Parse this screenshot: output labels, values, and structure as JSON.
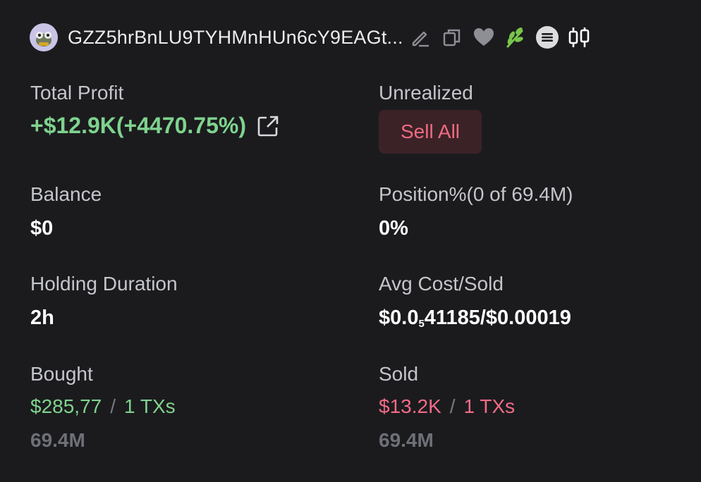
{
  "header": {
    "address": "GZZ5hrBnLU9TYHMnHUn6cY9EAGt..."
  },
  "total_profit": {
    "label": "Total Profit",
    "value": "+$12.9K(+4470.75%)"
  },
  "unrealized": {
    "label": "Unrealized",
    "sell_all_label": "Sell All"
  },
  "balance": {
    "label": "Balance",
    "value": "$0"
  },
  "position": {
    "label": "Position%(0 of 69.4M)",
    "value": "0%"
  },
  "holding_duration": {
    "label": "Holding Duration",
    "value": "2h"
  },
  "avg_cost_sold": {
    "label": "Avg Cost/Sold",
    "value_prefix": "$0.0",
    "value_subscript": "5",
    "value_suffix": "41185/$0.00019"
  },
  "bought": {
    "label": "Bought",
    "amount": "$285,77",
    "separator": "/",
    "txs": "1 TXs",
    "tokens": "69.4M"
  },
  "sold": {
    "label": "Sold",
    "amount": "$13.2K",
    "separator": "/",
    "txs": "1 TXs",
    "tokens": "69.4M"
  },
  "colors": {
    "background": "#1b1b1e",
    "profit_green": "#7fd38e",
    "loss_red": "#f26b85",
    "sell_button_bg": "#3b2227",
    "muted_grey": "#6e7077"
  },
  "icons": [
    "avatar-frog",
    "edit-icon",
    "copy-icon",
    "heart-icon",
    "leaf-icon",
    "menu-circle-icon",
    "candlestick-icon",
    "external-link-icon"
  ]
}
